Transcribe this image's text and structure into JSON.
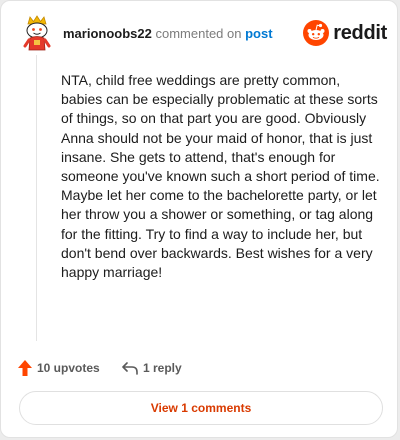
{
  "comment": {
    "username": "marionoobs22",
    "action_text": "commented on",
    "post_link": "post",
    "body": "NTA, child free weddings are pretty common, babies can be especially problematic at these sorts of things, so on that part you are good. Obviously Anna should not be your maid of honor, that is just insane. She gets to attend, that's enough for someone you've known such a short period of time. Maybe let her come to the bachelorette party, or let her throw you a shower or something, or tag along for the fitting. Try to find a way to include her, but don't bend over backwards. Best wishes for a very happy marriage!"
  },
  "brand": {
    "name": "reddit",
    "icon": "reddit-snoo-icon",
    "color": "#ff4500"
  },
  "actions": {
    "upvotes": "10 upvotes",
    "upvote_icon": "upvote-arrow-icon",
    "upvote_color": "#ff4500",
    "replies": "1 reply",
    "reply_icon": "reply-arrow-icon"
  },
  "view_comments": {
    "label": "View 1 comments",
    "color": "#d93a00"
  },
  "avatar": {
    "icon": "snoo-avatar-icon"
  }
}
